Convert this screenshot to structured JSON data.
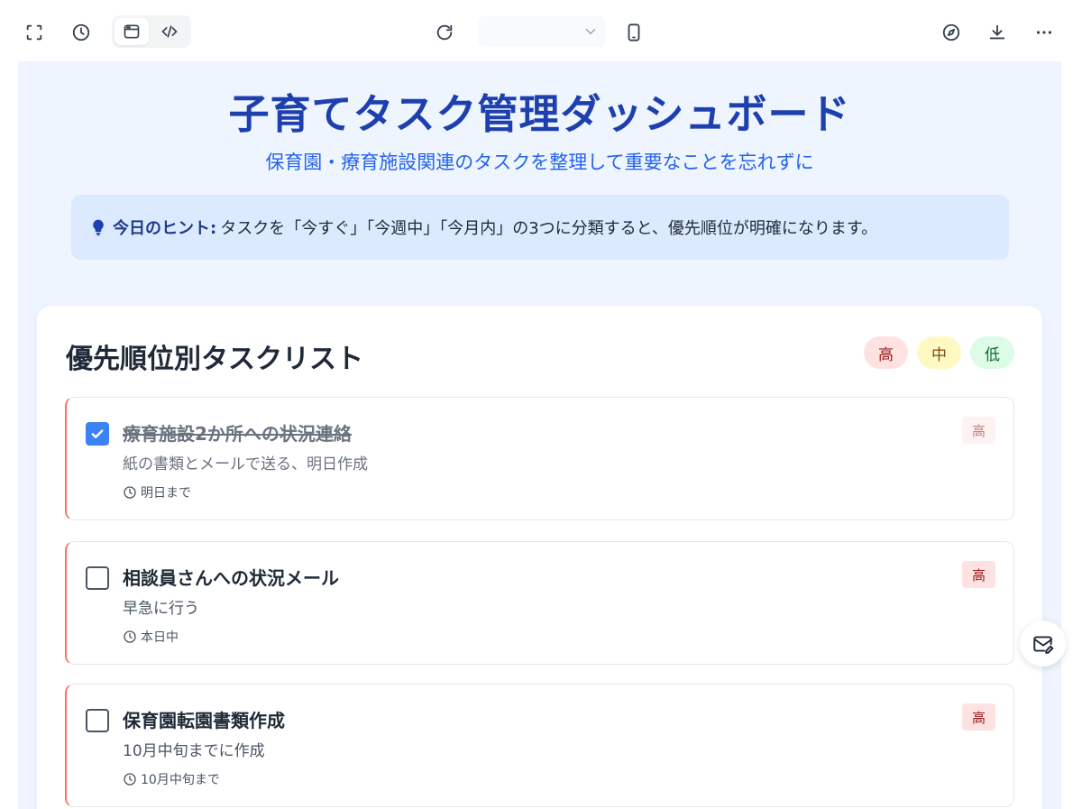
{
  "page": {
    "title": "子育てタスク管理ダッシュボード",
    "subtitle": "保育園・療育施設関連のタスクを整理して重要なことを忘れずに",
    "hint": {
      "label": "今日のヒント:",
      "text": "タスクを「今すぐ」「今週中」「今月内」の3つに分類すると、優先順位が明確になります。"
    }
  },
  "task_list": {
    "title": "優先順位別タスクリスト",
    "legend": [
      {
        "label": "高",
        "level": "high"
      },
      {
        "label": "中",
        "level": "mid"
      },
      {
        "label": "低",
        "level": "low"
      }
    ],
    "tasks": [
      {
        "title": "療育施設2か所への状況連絡",
        "description": "紙の書類とメールで送る、明日作成",
        "due": "明日まで",
        "priority": "高",
        "done": true
      },
      {
        "title": "相談員さんへの状況メール",
        "description": "早急に行う",
        "due": "本日中",
        "priority": "高",
        "done": false
      },
      {
        "title": "保育園転園書類作成",
        "description": "10月中旬までに作成",
        "due": "10月中旬まで",
        "priority": "高",
        "done": false
      }
    ]
  },
  "colors": {
    "brand": "#1e40af",
    "accent": "#2563eb",
    "high": "#fee2e2",
    "mid": "#fef9c3",
    "low": "#dcfce7",
    "check": "#3b82f6"
  },
  "icons": {
    "toolbar_left": [
      "fullscreen-icon",
      "history-icon",
      "preview-icon",
      "code-icon"
    ],
    "toolbar_center": [
      "refresh-icon",
      "chevron-down-icon",
      "mobile-icon"
    ],
    "toolbar_right": [
      "compass-icon",
      "download-icon",
      "more-icon"
    ],
    "floating": "mail-edit-icon"
  }
}
